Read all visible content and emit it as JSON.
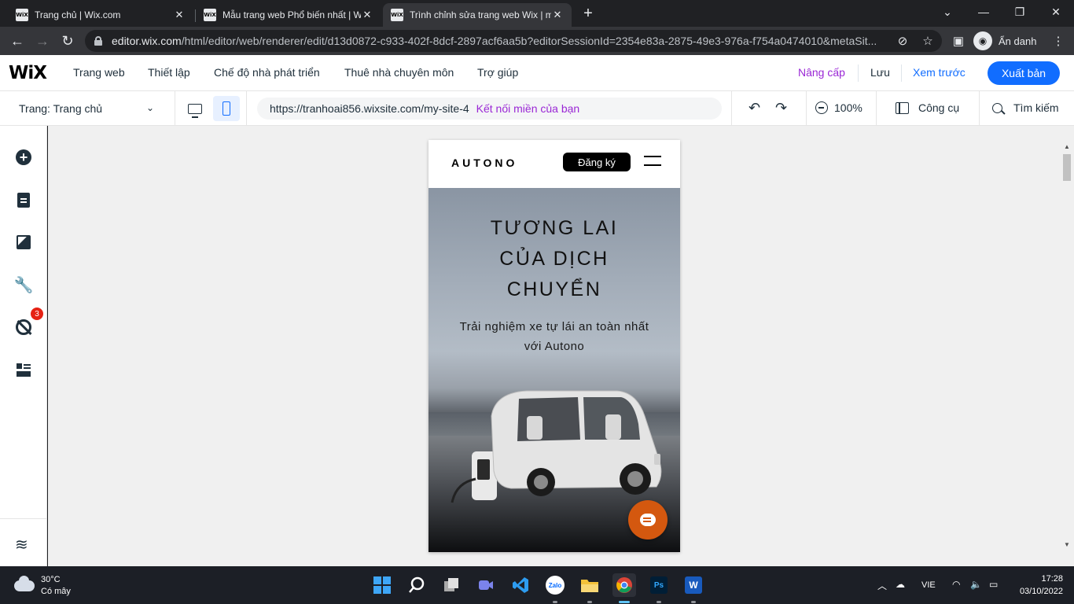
{
  "browser": {
    "tabs": [
      {
        "title": "Trang chủ | Wix.com",
        "favicon": "WiX"
      },
      {
        "title": "Mẫu trang web Phổ biến nhất | Wix",
        "favicon": "WiX"
      },
      {
        "title": "Trình chỉnh sửa trang web Wix | my",
        "favicon": "WiX"
      }
    ],
    "address_host": "editor.wix.com",
    "address_path": "/html/editor/web/renderer/edit/d13d0872-c933-402f-8dcf-2897acf6aa5b?editorSessionId=2354e83a-2875-49e3-976a-f754a0474010&metaSit...",
    "profile_label": "Ẩn danh"
  },
  "editor": {
    "logo": "WiX",
    "menu": [
      "Trang web",
      "Thiết lập",
      "Chế độ nhà phát triển",
      "Thuê nhà chuyên môn",
      "Trợ giúp"
    ],
    "upgrade": "Nâng cấp",
    "save": "Lưu",
    "preview": "Xem trước",
    "publish": "Xuất bản",
    "page_selector": "Trang: Trang chủ",
    "site_url": "https://tranhoai856.wixsite.com/my-site-4",
    "connect_domain": "Kết nối miền của bạn",
    "zoom": "100%",
    "tools": "Công cụ",
    "search": "Tìm kiếm",
    "notification_count": "3",
    "accent_color": "#116dff",
    "upgrade_color": "#9a27d5"
  },
  "site": {
    "logo": "AUTONO",
    "signup": "Đăng ký",
    "hero_title_lines": [
      "TƯƠNG LAI",
      "CỦA DỊCH",
      "CHUYỂN"
    ],
    "hero_subtitle_lines": [
      "Trải nghiệm xe tự lái an toàn nhất",
      "với Autono"
    ],
    "chat_color": "#d4580f"
  },
  "taskbar": {
    "temperature": "30°C",
    "weather": "Có mây",
    "apps": [
      "start",
      "search",
      "task-view",
      "meet",
      "vscode",
      "Zalo",
      "file-explorer",
      "chrome",
      "Ps",
      "W"
    ],
    "language": "VIE",
    "time": "17:28",
    "date": "03/10/2022"
  }
}
